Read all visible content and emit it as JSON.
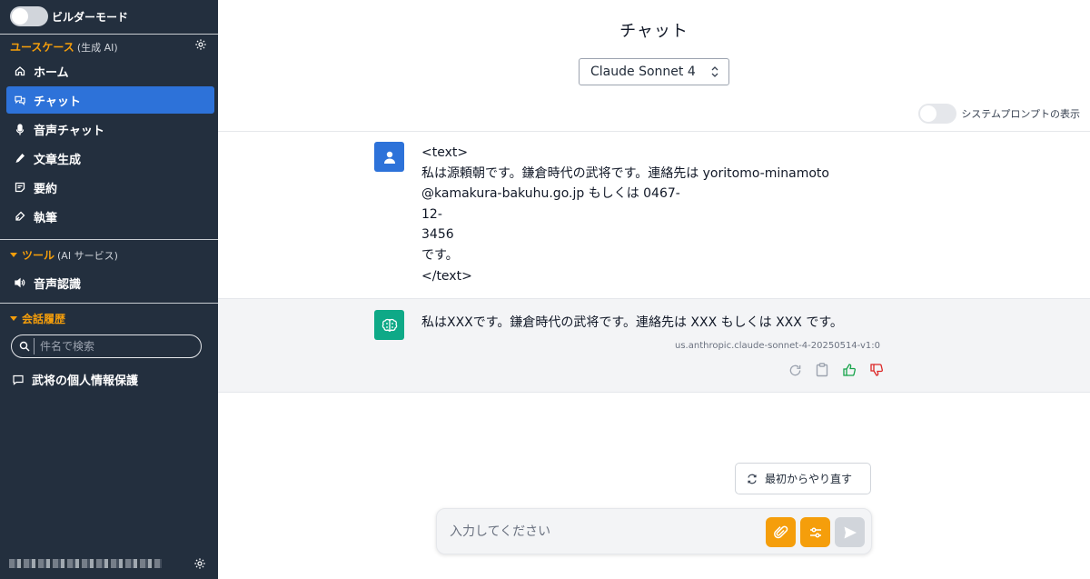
{
  "app": {
    "builder_mode_label": "ビルダーモード",
    "user_name": "■■■■■■■■"
  },
  "sidebar": {
    "usecases": {
      "title": "ユースケース",
      "subtitle": "(生成 AI)"
    },
    "items": [
      {
        "label": "ホーム",
        "icon": "home-icon"
      },
      {
        "label": "チャット",
        "icon": "chat-icon",
        "active": true
      },
      {
        "label": "音声チャット",
        "icon": "mic-icon"
      },
      {
        "label": "文章生成",
        "icon": "pencil-icon"
      },
      {
        "label": "要約",
        "icon": "summary-icon"
      },
      {
        "label": "執筆",
        "icon": "pen-icon"
      }
    ],
    "tools": {
      "title": "ツール",
      "subtitle": "(AI サービス)",
      "items": [
        {
          "label": "音声認識",
          "icon": "speaker-icon"
        }
      ]
    },
    "history": {
      "title": "会話履歴",
      "search_placeholder": "件名で検索",
      "items": [
        {
          "label": "武将の個人情報保護",
          "icon": "comment-icon"
        }
      ]
    }
  },
  "main": {
    "title": "チャット",
    "model_select": "Claude Sonnet 4",
    "system_prompt_toggle": "システムプロンプトの表示",
    "messages": [
      {
        "role": "user",
        "text": "<text>\n私は源頼朝です。鎌倉時代の武将です。連絡先は yoritomo-minamoto\n@kamakura-bakuhu.go.jp もしくは 0467-\n12-\n3456\nです。\n</text>"
      },
      {
        "role": "assistant",
        "text": "私はXXXです。鎌倉時代の武将です。連絡先は XXX もしくは XXX です。",
        "model_id": "us.anthropic.claude-sonnet-4-20250514-v1:0"
      }
    ],
    "restart_label": "最初からやり直す",
    "input_placeholder": "入力してください"
  },
  "colors": {
    "sidebar": "#232f3e",
    "accent_blue": "#2d72d9",
    "accent_orange": "#f59e0b",
    "ai_green": "#0ea987"
  }
}
